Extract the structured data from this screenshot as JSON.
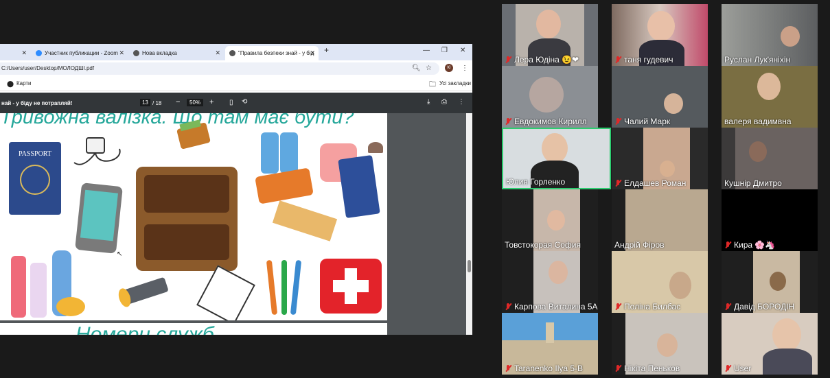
{
  "browser": {
    "tabs": [
      {
        "label": "",
        "favicon": "globe-icon"
      },
      {
        "label": "Участник публикации - Zoom",
        "favicon": "zoom-icon"
      },
      {
        "label": "Нова вкладка",
        "favicon": "chrome-icon"
      },
      {
        "label": "\"Правила безпеки знай - у бід",
        "favicon": "chrome-icon"
      }
    ],
    "address": "C:/Users/user/Desktop/МОЛОДШІ.pdf",
    "bookmarks": {
      "maps": "Карти",
      "all": "Усі закладки"
    },
    "pdf": {
      "title": "най - у біду не потрапляй!",
      "page_current": "13",
      "page_total": "/ 18",
      "zoom": "50%",
      "heading": "Тривожна валізка. Що там має бути?",
      "passport": "PASSPORT",
      "next_heading": "Номери служб"
    }
  },
  "gallery": {
    "accent": "#2dcc70",
    "participants": [
      {
        "name": "Лера Юдіна 😉❤"
      },
      {
        "name": "таня гудевич"
      },
      {
        "name": "Руслан Лук'яніхін"
      },
      {
        "name": "Евдокимов Кирилл"
      },
      {
        "name": "Чалий Марк"
      },
      {
        "name": "валеря вадимвна"
      },
      {
        "name": "Юлия Горленко"
      },
      {
        "name": "Елдашев Роман"
      },
      {
        "name": "Кушнір Дмитро"
      },
      {
        "name": "Товстокорая София"
      },
      {
        "name": "Андрій  Фіров"
      },
      {
        "name": "Кира 🌸🦄"
      },
      {
        "name": "Карпова Виталина 5А"
      },
      {
        "name": "Поліна Билбас"
      },
      {
        "name": "Давід БОРОДІН"
      },
      {
        "name": "Taranenko Ilya 5-B"
      },
      {
        "name": "Нікіта Пеньков"
      },
      {
        "name": "User"
      }
    ]
  }
}
